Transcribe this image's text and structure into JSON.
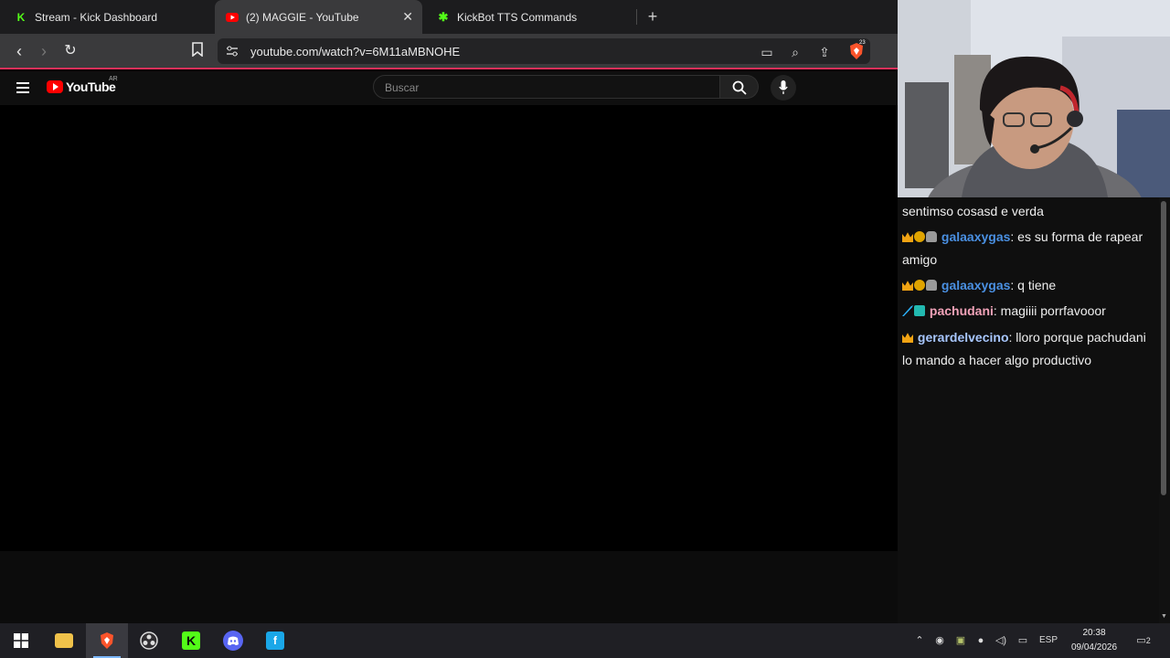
{
  "tabs": [
    {
      "title": "Stream - Kick Dashboard",
      "active": false
    },
    {
      "title": "(2) MAGGIE - YouTube",
      "active": true
    },
    {
      "title": "KickBot TTS Commands",
      "active": false
    }
  ],
  "address_bar": {
    "url": "youtube.com/watch?v=6M11aMBNOHE"
  },
  "brave_badge": "23",
  "youtube": {
    "wordmark": "YouTube",
    "region": "AR",
    "search_placeholder": "Buscar"
  },
  "chat": {
    "messages": [
      {
        "user": "",
        "text": "sentimso cosasd e verda",
        "badges": []
      },
      {
        "user": "galaaxygas",
        "text": ": es su forma de rapear amigo",
        "badges": [
          "crown",
          "coin",
          "stone"
        ],
        "user_color": "#4a90e2"
      },
      {
        "user": "galaaxygas",
        "text": ": q tiene",
        "badges": [
          "crown",
          "coin",
          "stone"
        ],
        "user_color": "#4a90e2"
      },
      {
        "user": "pachudani",
        "text": ": magiiii porrfavooor",
        "badges": [
          "sword",
          "cube"
        ],
        "user_color": "#f1a2b8"
      },
      {
        "user": "gerardelvecino",
        "text": ": lloro porque pachudani lo mando a hacer algo productivo",
        "badges": [
          "crown"
        ],
        "user_color": "#a8c7ff"
      }
    ],
    "lines": {
      "m0": "sentimso cosasd e verda",
      "m1_user": "galaaxygas",
      "m1_text_a": ": es su forma de rapear",
      "m1_text_b": "amigo",
      "m2_user": "galaaxygas",
      "m2_text": ": q tiene",
      "m3_user": "pachudani",
      "m3_text": ": magiiii porrfavooor",
      "m4_user": "gerardelvecino",
      "m4_text_a": ": lloro porque pachudani",
      "m4_text_b": "lo mando a hacer algo productivo"
    }
  },
  "taskbar": {
    "apps": [
      "windows-start",
      "file-explorer",
      "brave",
      "obs",
      "kick",
      "discord",
      "app"
    ],
    "active_app": "brave",
    "language": "ESP",
    "time": "20:38",
    "date": "09/04/2026",
    "notifications": "2"
  },
  "colors": {
    "accent_bar": "#e0305a",
    "kick_green": "#53fc18",
    "youtube_red": "#ff0000"
  }
}
